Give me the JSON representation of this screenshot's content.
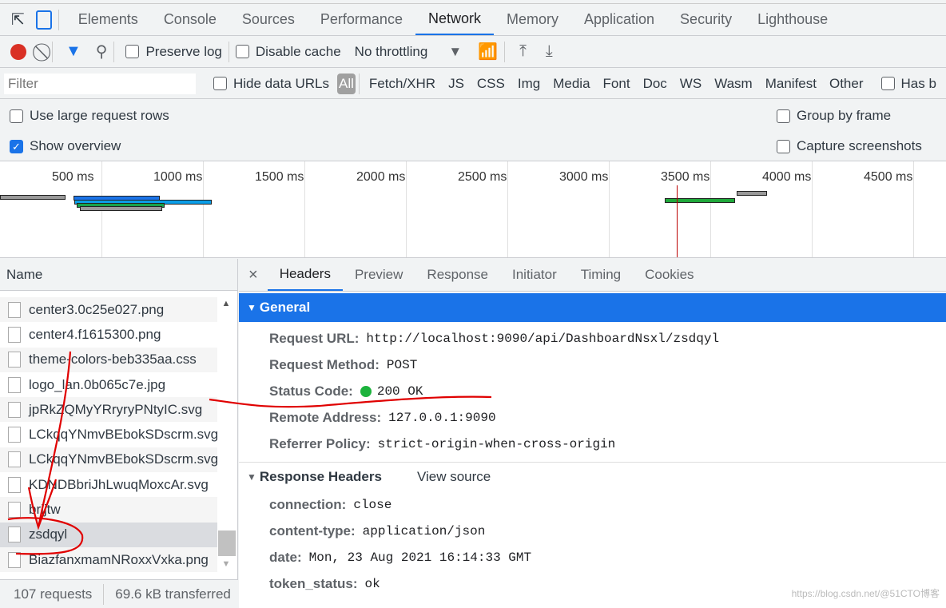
{
  "tabs": [
    "Elements",
    "Console",
    "Sources",
    "Performance",
    "Network",
    "Memory",
    "Application",
    "Security",
    "Lighthouse"
  ],
  "active_tab": "Network",
  "toolbar": {
    "preserve_log": "Preserve log",
    "disable_cache": "Disable cache",
    "throttling": "No throttling"
  },
  "filter": {
    "placeholder": "Filter",
    "hide_data_urls": "Hide data URLs",
    "types": [
      "All",
      "Fetch/XHR",
      "JS",
      "CSS",
      "Img",
      "Media",
      "Font",
      "Doc",
      "WS",
      "Wasm",
      "Manifest",
      "Other"
    ],
    "has_blocked": "Has b"
  },
  "options": {
    "large_rows": "Use large request rows",
    "show_overview": "Show overview",
    "group_by_frame": "Group by frame",
    "capture_screenshots": "Capture screenshots",
    "show_overview_checked": true
  },
  "overview": {
    "ticks": [
      "500 ms",
      "1000 ms",
      "1500 ms",
      "2000 ms",
      "2500 ms",
      "3000 ms",
      "3500 ms",
      "4000 ms",
      "4500 ms"
    ]
  },
  "requests": {
    "header": "Name",
    "items": [
      "center3.0c25e027.png",
      "center4.f1615300.png",
      "theme-colors-beb335aa.css",
      "logo_lan.0b065c7e.jpg",
      "jpRkZQMyYRryryPNtyIC.svg",
      "LCkqqYNmvBEbokSDscrm.svg",
      "LCkqqYNmvBEbokSDscrm.svg",
      "KDNDBbriJhLwuqMoxcAr.svg",
      "brijtw",
      "zsdqyl",
      "BiazfanxmamNRoxxVxka.png"
    ],
    "selected": "zsdqyl",
    "count": "107 requests",
    "transferred": "69.6 kB transferred"
  },
  "detail": {
    "tabs": [
      "Headers",
      "Preview",
      "Response",
      "Initiator",
      "Timing",
      "Cookies"
    ],
    "active": "Headers",
    "general_title": "General",
    "general": [
      {
        "k": "Request URL:",
        "v": "http://localhost:9090/api/DashboardNsxl/zsdqyl"
      },
      {
        "k": "Request Method:",
        "v": "POST"
      },
      {
        "k": "Status Code:",
        "v": "200 OK"
      },
      {
        "k": "Remote Address:",
        "v": "127.0.0.1:9090"
      },
      {
        "k": "Referrer Policy:",
        "v": "strict-origin-when-cross-origin"
      }
    ],
    "response_title": "Response Headers",
    "view_source": "View source",
    "response": [
      {
        "k": "connection:",
        "v": "close"
      },
      {
        "k": "content-type:",
        "v": "application/json"
      },
      {
        "k": "date:",
        "v": "Mon, 23 Aug 2021 16:14:33 GMT"
      },
      {
        "k": "token_status:",
        "v": "ok"
      }
    ]
  },
  "watermark": "https://blog.csdn.net/@51CTO博客",
  "colors": {
    "accent": "#1a73e8",
    "record": "#d93025",
    "annotation": "#e00000"
  }
}
